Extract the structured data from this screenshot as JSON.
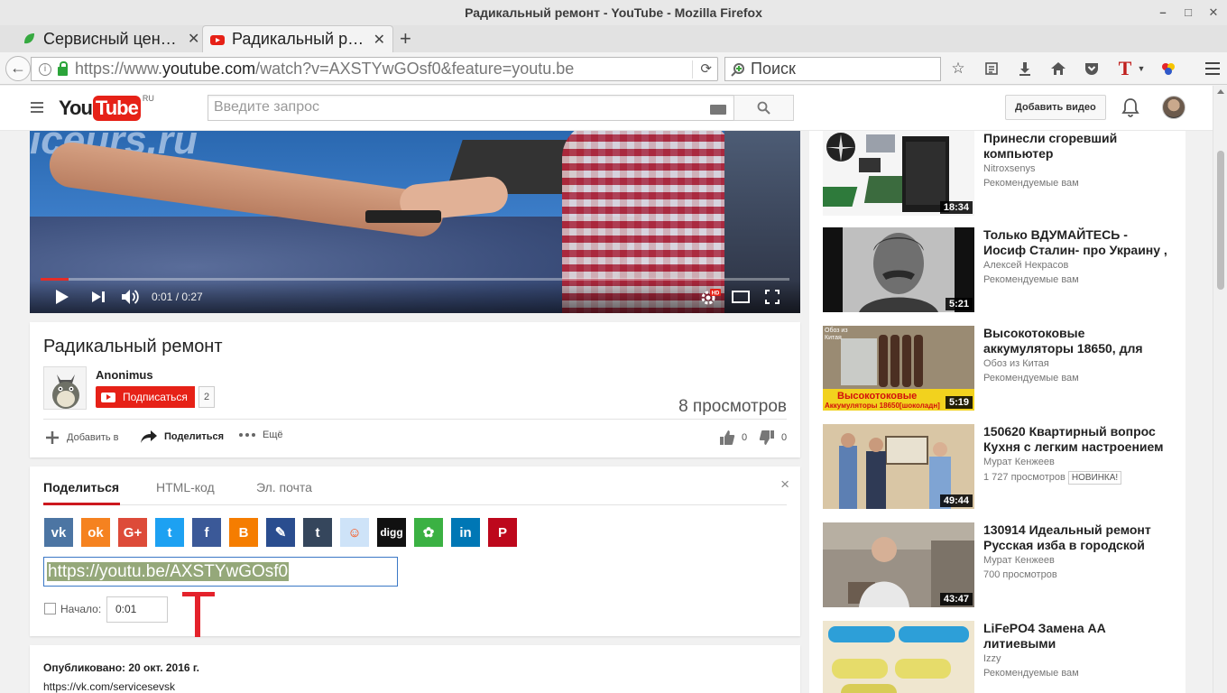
{
  "window": {
    "title": "Радикальный ремонт - YouTube - Mozilla Firefox",
    "controls": {
      "minimize": "–",
      "maximize": "□",
      "close": "✕"
    }
  },
  "tabs": [
    {
      "title": "Сервисный цен…",
      "active": false,
      "close": "✕"
    },
    {
      "title": "Радикальный р…",
      "active": true,
      "close": "✕"
    }
  ],
  "new_tab": "+",
  "navbar": {
    "url_prefix": "https://www.",
    "url_domain": "youtube.com",
    "url_rest": "/watch?v=AXSTYwGOsf0&feature=youtu.be",
    "search_placeholder": "Поиск"
  },
  "masthead": {
    "logo_you": "You",
    "logo_tube": "Tube",
    "logo_region": "RU",
    "search_placeholder": "Введите запрос",
    "upload_label": "Добавить видео"
  },
  "player": {
    "watermark": "iceurs.ru",
    "current_time": "0:01",
    "duration": "0:27",
    "progress": 0.037,
    "hd_badge": "HD"
  },
  "video": {
    "title": "Радикальный ремонт",
    "owner": "Anonimus",
    "subscribe_label": "Подписаться",
    "subscriber_count": "2",
    "views": "8 просмотров",
    "actions": {
      "add_to": "Добавить в",
      "share": "Поделиться",
      "more": "Ещё"
    },
    "likes": "0",
    "dislikes": "0"
  },
  "share": {
    "tabs": [
      "Поделиться",
      "HTML-код",
      "Эл. почта"
    ],
    "close": "×",
    "networks": [
      {
        "name": "vk",
        "color": "#4c75a3",
        "glyph": "vk"
      },
      {
        "name": "odnoklassniki",
        "color": "#f58220",
        "glyph": "ok"
      },
      {
        "name": "google-plus",
        "color": "#dd4b39",
        "glyph": "G+"
      },
      {
        "name": "twitter",
        "color": "#1da1f2",
        "glyph": "t"
      },
      {
        "name": "facebook",
        "color": "#3b5998",
        "glyph": "f"
      },
      {
        "name": "blogger",
        "color": "#f57d00",
        "glyph": "B"
      },
      {
        "name": "livejournal",
        "color": "#2a4d8f",
        "glyph": "✎"
      },
      {
        "name": "tumblr",
        "color": "#35465c",
        "glyph": "t"
      },
      {
        "name": "reddit",
        "color": "#cee3f8",
        "glyph": "☺"
      },
      {
        "name": "digg",
        "color": "#111111",
        "glyph": "digg"
      },
      {
        "name": "mixi",
        "color": "#3bb143",
        "glyph": "✿"
      },
      {
        "name": "linkedin",
        "color": "#0077b5",
        "glyph": "in"
      },
      {
        "name": "pinterest",
        "color": "#bd081c",
        "glyph": "P"
      }
    ],
    "url": "https://youtu.be/AXSTYwGOsf0",
    "start_label": "Начало:",
    "start_time": "0:01"
  },
  "description": {
    "published": "Опубликовано: 20 окт. 2016 г.",
    "link": "https://vk.com/servicesevsk"
  },
  "recommendations": [
    {
      "title": "Принесли сгоревший компьютер",
      "channel": "Nitroxsenys",
      "meta": "Рекомендуемые вам",
      "duration": "18:34",
      "badge": ""
    },
    {
      "title": "Только ВДУМАЙТЕСЬ - Иосиф Сталин- про Украину ,",
      "channel": "Алексей Некрасов",
      "meta": "Рекомендуемые вам",
      "duration": "5:21",
      "badge": ""
    },
    {
      "title": "Высокотоковые аккумуляторы 18650, для",
      "channel": "Обоз из Китая",
      "meta": "Рекомендуемые вам",
      "duration": "5:19",
      "badge": "",
      "thumb_caption1": "Высокотоковые",
      "thumb_caption2": "Аккумуляторы 18650[шоколадн]",
      "thumb_corner": "Обоз из Китая"
    },
    {
      "title": "150620 Квартирный вопрос Кухня с легким настроением",
      "channel": "Мурат Кенжеев",
      "meta": "1 727 просмотров",
      "duration": "49:44",
      "badge": "НОВИНКА!"
    },
    {
      "title": "130914 Идеальный ремонт Русская изба в городской",
      "channel": "Мурат Кенжеев",
      "meta": "700 просмотров",
      "duration": "43:47",
      "badge": ""
    },
    {
      "title": "LiFePO4 Замена AA литиевыми",
      "channel": "Izzy",
      "meta": "Рекомендуемые вам",
      "duration": "",
      "badge": ""
    }
  ],
  "colors": {
    "youtube_red": "#e62117",
    "link_blue": "#3b78c6",
    "selection": "#95a87a"
  }
}
